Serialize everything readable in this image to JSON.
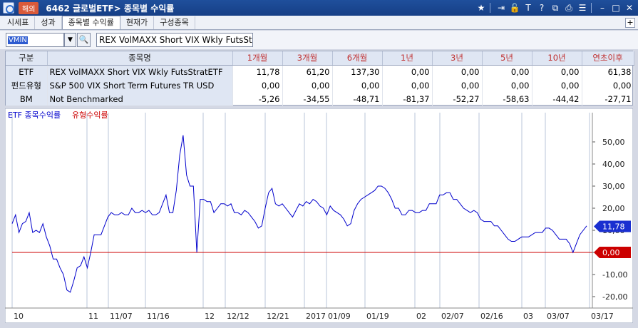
{
  "window": {
    "badge": "해외",
    "title": "6462 글로벌ETF> 종목별 수익률",
    "icons": [
      "star-icon",
      "export-icon",
      "lock-icon",
      "text-icon",
      "help-icon",
      "link-icon",
      "print-icon",
      "settings-icon",
      "minimize-icon",
      "maximize-icon",
      "close-icon"
    ]
  },
  "tabs": [
    {
      "label": "시세표"
    },
    {
      "label": "성과"
    },
    {
      "label": "종목별 수익률"
    },
    {
      "label": "현재가"
    },
    {
      "label": "구성종목"
    }
  ],
  "tab_add": "+",
  "search": {
    "code": "VMIN",
    "name": "REX VolMAXX Short VIX Wkly FutsStrat"
  },
  "table": {
    "headers": [
      "구분",
      "종목명",
      "1개월",
      "3개월",
      "6개월",
      "1년",
      "3년",
      "5년",
      "10년",
      "연초이후"
    ],
    "rows": [
      {
        "type": "ETF",
        "name": "REX VolMAXX Short VIX Wkly FutsStratETF",
        "values": [
          "11,78",
          "61,20",
          "137,30",
          "0,00",
          "0,00",
          "0,00",
          "0,00",
          "61,38"
        ]
      },
      {
        "type": "펀드유형",
        "name": "S&P 500 VIX Short Term Futures TR USD",
        "values": [
          "0,00",
          "0,00",
          "0,00",
          "0,00",
          "0,00",
          "0,00",
          "0,00",
          "0,00"
        ]
      },
      {
        "type": "BM",
        "name": "Not Benchmarked",
        "values": [
          "-5,26",
          "-34,55",
          "-48,71",
          "-81,37",
          "-52,27",
          "-58,63",
          "-44,42",
          "-27,71"
        ]
      }
    ]
  },
  "chart_data": {
    "type": "line",
    "legend": [
      {
        "label": "ETF 종목수익률",
        "color": "#0000cc"
      },
      {
        "label": "유형수익률",
        "color": "#cc0000"
      }
    ],
    "yticks": [
      "50,00",
      "40,00",
      "30,00",
      "20,00",
      "10,00",
      "0,00",
      "-10,00",
      "-20,00"
    ],
    "ylim": [
      -25,
      60
    ],
    "xticks": [
      "10",
      "11",
      "11/07",
      "11/16",
      "12",
      "12/12",
      "12/21",
      "2017",
      "01/09",
      "01/19",
      "02",
      "02/07",
      "02/16",
      "03",
      "03/07",
      "03/17"
    ],
    "series": [
      {
        "color": "#0000cc",
        "values": [
          13,
          17,
          9,
          13,
          14,
          18,
          9,
          10,
          9,
          13,
          7,
          3,
          -3,
          -3,
          -7,
          -10,
          -17,
          -18,
          -13,
          -7,
          -6,
          -2,
          -7,
          0,
          8,
          8,
          8,
          12,
          16,
          18,
          17,
          17,
          18,
          17,
          17,
          20,
          18,
          18,
          19,
          18,
          19,
          17,
          17,
          18,
          22,
          26,
          18,
          18,
          28,
          44,
          53,
          35,
          30,
          30,
          0,
          24,
          24,
          23,
          23,
          18,
          20,
          22,
          22,
          21,
          22,
          18,
          18,
          17,
          19,
          18,
          16,
          14,
          11,
          12,
          20,
          27,
          29,
          22,
          21,
          22,
          20,
          18,
          16,
          19,
          22,
          21,
          23,
          22,
          24,
          23,
          21,
          20,
          17,
          21,
          19,
          18,
          17,
          15,
          12,
          13,
          19,
          22,
          24,
          25,
          26,
          27,
          28,
          30,
          30,
          29,
          27,
          24,
          20,
          20,
          17,
          17,
          19,
          19,
          18,
          18,
          19,
          19,
          22,
          22,
          22,
          26,
          26,
          27,
          27,
          24,
          24,
          22,
          20,
          19,
          18,
          19,
          18,
          15,
          14,
          14,
          14,
          12,
          12,
          10,
          8,
          6,
          5,
          5,
          6,
          7,
          7,
          7,
          8,
          9,
          9,
          9,
          11,
          11,
          10,
          8,
          6,
          6,
          6,
          4,
          0,
          4,
          8,
          10,
          12
        ]
      },
      {
        "color": "#cc0000",
        "values": [
          0,
          0
        ]
      }
    ],
    "tag_etf": "11,78",
    "tag_type": "0,00"
  }
}
